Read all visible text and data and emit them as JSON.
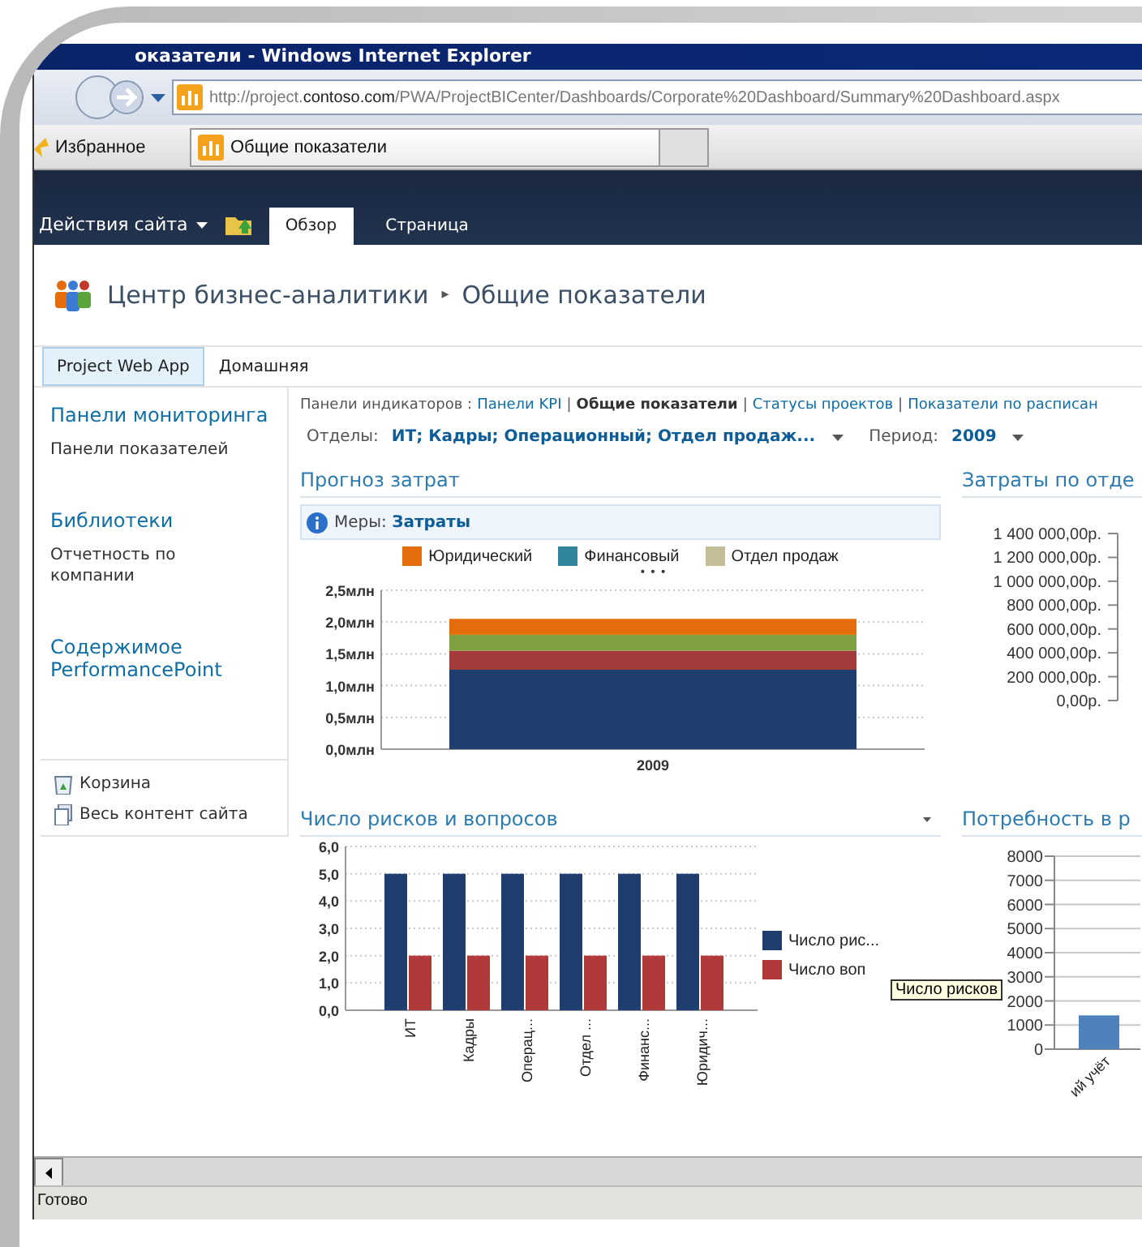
{
  "window": {
    "title": "оказатели - Windows Internet Explorer"
  },
  "address_bar": {
    "url_prefix": "http://project.",
    "url_domain": "contoso.com",
    "url_path": "/PWA/ProjectBICenter/Dashboards/Corporate%20Dashboard/Summary%20Dashboard.aspx"
  },
  "favorites_bar": {
    "favorites": "Избранное",
    "tab": "Общие показатели"
  },
  "ribbon": {
    "site_actions": "Действия сайта",
    "tabs": [
      {
        "label": "Обзор",
        "selected": true
      },
      {
        "label": "Страница",
        "selected": false
      }
    ]
  },
  "breadcrumb": [
    "Центр бизнес-аналитики",
    "Общие показатели"
  ],
  "breadcrumb_separator": "▸",
  "top_nav": [
    {
      "label": "Project Web App",
      "selected": true
    },
    {
      "label": "Домашняя",
      "selected": false
    }
  ],
  "sidebar": {
    "sections": [
      {
        "heading": "Панели мониторинга",
        "items": [
          "Панели показателей"
        ]
      },
      {
        "heading": "Библиотеки",
        "items": [
          "Отчетность по компании"
        ]
      },
      {
        "heading": "Содержимое PerformancePoint"
      }
    ],
    "links": [
      {
        "kind": "recycle",
        "label": "Корзина"
      },
      {
        "kind": "content",
        "label": "Весь контент сайта"
      }
    ]
  },
  "dashboard_nav": {
    "label": "Панели индикаторов :",
    "separator": "|",
    "pages": [
      {
        "label": "Панели KPI",
        "selected": false
      },
      {
        "label": "Общие показатели",
        "selected": true
      },
      {
        "label": "Статусы проектов",
        "selected": false
      },
      {
        "label": "Показатели по расписан",
        "selected": false
      }
    ]
  },
  "filters": [
    {
      "label": "Отделы:",
      "value": "ИТ; Кадры; Операционный; Отдел продаж..."
    },
    {
      "label": "Период:",
      "value": "2009"
    }
  ],
  "charts": [
    {
      "title": "Прогноз затрат",
      "info_label": "Меры:",
      "info_value": "Затраты",
      "legend": [
        {
          "name": "Юридический",
          "color": "#e46c0a"
        },
        {
          "name": "Финансовый",
          "color": "#31859c"
        },
        {
          "name": "Отдел продаж",
          "color": "#c4bd97"
        }
      ],
      "legend_more": "• • •",
      "chart_data": {
        "type": "bar",
        "stacked": true,
        "grid": true,
        "categories": [
          "2009"
        ],
        "series": [
          {
            "name": null,
            "color": "#1f3d6e",
            "values": [
              1.25
            ]
          },
          {
            "name": null,
            "color": "#a33b3b",
            "values": [
              0.3
            ]
          },
          {
            "name": null,
            "color": "#7ea041",
            "values": [
              0.25
            ]
          },
          {
            "name": null,
            "color": "#e46c0a",
            "values": [
              0.25
            ]
          }
        ],
        "ylim": [
          0,
          2.5
        ],
        "yticks": [
          {
            "value": 0,
            "label": "0,0млн"
          },
          {
            "value": 0.5,
            "label": "0,5млн"
          },
          {
            "value": 1,
            "label": "1,0млн"
          },
          {
            "value": 1.5,
            "label": "1,5млн"
          },
          {
            "value": 2,
            "label": "2,0млн"
          },
          {
            "value": 2.5,
            "label": "2,5млн"
          }
        ]
      }
    },
    {
      "title": "Затраты по отде",
      "axis_labels": [
        "1 400 000,00р.",
        "1 200 000,00р.",
        "1 000 000,00р.",
        "800 000,00р.",
        "600 000,00р.",
        "400 000,00р.",
        "200 000,00р.",
        "0,00р."
      ]
    },
    {
      "title": "Число рисков и вопросов",
      "tooltip": "Число рисков",
      "chart_data": {
        "type": "bar",
        "grid": true,
        "categories": [
          "ИТ",
          "Кадры",
          "Операц...",
          "Отдел ...",
          "Финанс...",
          "Юридич..."
        ],
        "series": [
          {
            "name": "Число рис...",
            "color": "#1f3d6e",
            "values": [
              5,
              5,
              5,
              5,
              5,
              5
            ]
          },
          {
            "name": "Число воп",
            "color": "#b03a3a",
            "values": [
              2,
              2,
              2,
              2,
              2,
              2
            ]
          }
        ],
        "ylim": [
          0,
          6
        ],
        "yticks": [
          {
            "value": 0,
            "label": "0,0"
          },
          {
            "value": 1,
            "label": "1,0"
          },
          {
            "value": 2,
            "label": "2,0"
          },
          {
            "value": 3,
            "label": "3,0"
          },
          {
            "value": 4,
            "label": "4,0"
          },
          {
            "value": 5,
            "label": "5,0"
          },
          {
            "value": 6,
            "label": "6,0"
          }
        ]
      }
    },
    {
      "title": "Потребность в р",
      "chart_data": {
        "type": "bar",
        "grid": true,
        "categories": [
          "ий учёт"
        ],
        "series": [
          {
            "name": null,
            "color": "#4f81bd",
            "values": [
              1400
            ]
          }
        ],
        "ylim": [
          0,
          8000
        ],
        "yticks": [
          {
            "value": 0,
            "label": "0"
          },
          {
            "value": 1000,
            "label": "1000"
          },
          {
            "value": 2000,
            "label": "2000"
          },
          {
            "value": 3000,
            "label": "3000"
          },
          {
            "value": 4000,
            "label": "4000"
          },
          {
            "value": 5000,
            "label": "5000"
          },
          {
            "value": 6000,
            "label": "6000"
          },
          {
            "value": 7000,
            "label": "7000"
          },
          {
            "value": 8000,
            "label": "8000"
          }
        ]
      }
    }
  ],
  "status_bar": "Готово"
}
